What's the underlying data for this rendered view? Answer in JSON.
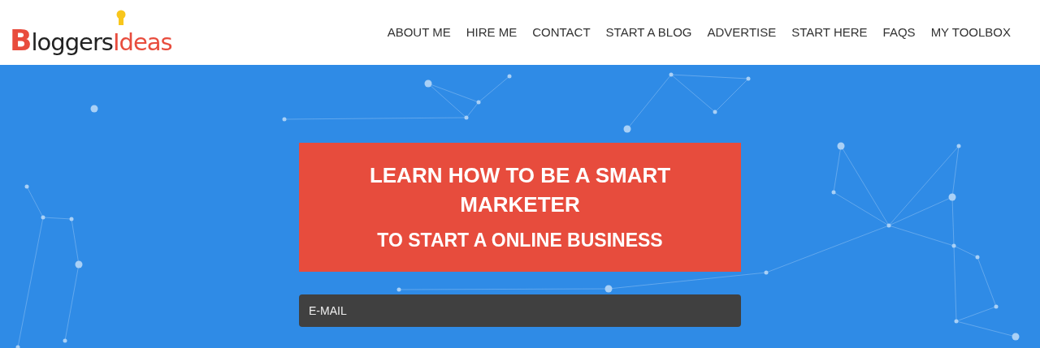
{
  "logo": {
    "first": "Bloggers",
    "second": "Ideas"
  },
  "nav": [
    {
      "label": "ABOUT ME"
    },
    {
      "label": "HIRE ME"
    },
    {
      "label": "CONTACT"
    },
    {
      "label": "START A BLOG"
    },
    {
      "label": "ADVERTISE"
    },
    {
      "label": "START HERE"
    },
    {
      "label": "FAQS"
    },
    {
      "label": "MY TOOLBOX"
    }
  ],
  "hero": {
    "headline": "LEARN HOW TO BE A SMART MARKETER",
    "subheadline": "TO START A ONLINE BUSINESS",
    "email": {
      "placeholder": "E-MAIL"
    }
  }
}
